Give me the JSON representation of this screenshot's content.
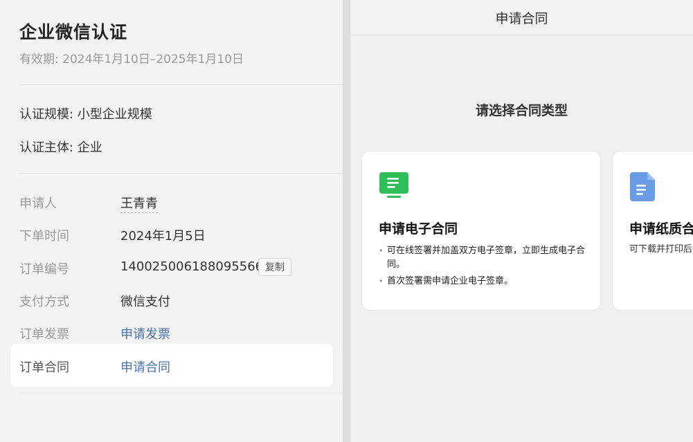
{
  "left": {
    "title": "企业微信认证",
    "validity": "有效期: 2024年1月10日–2025年1月10日",
    "scale": "认证规模: 小型企业规模",
    "subject": "认证主体: 企业",
    "rows": [
      {
        "label": "申请人",
        "value": "王青青"
      },
      {
        "label": "下单时间",
        "value": "2024年1月5日"
      },
      {
        "label": "订单编号",
        "value": "140025006188095566"
      },
      {
        "label": "支付方式",
        "value": "微信支付"
      },
      {
        "label": "订单发票",
        "value": "申请发票"
      },
      {
        "label": "订单合同",
        "value": "申请合同"
      }
    ],
    "copy_label": "复制"
  },
  "right": {
    "header_title": "申请合同",
    "choose_title": "请选择合同类型",
    "electronic": {
      "title": "申请电子合同",
      "bullets": [
        "可在线签署并加盖双方电子签章，立即生成电子合同。",
        "首次签署需申请企业电子签章。"
      ],
      "icon": "monitor-document-icon",
      "icon_color": "#2ebd59"
    },
    "paper": {
      "title": "申请纸质合同",
      "desc": "可下载并打印后寄回。",
      "icon": "document-icon",
      "icon_color": "#6a9be6"
    }
  },
  "colors": {
    "link": "#4a72b2",
    "green": "#2ebd59",
    "blue": "#6a9be6"
  }
}
